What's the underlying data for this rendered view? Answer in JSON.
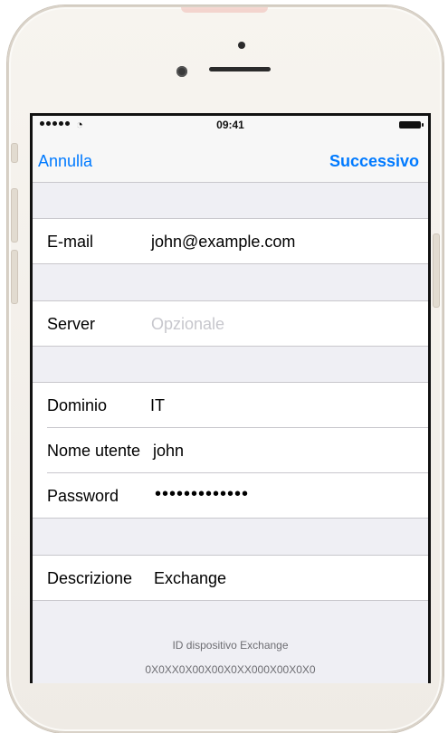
{
  "status_bar": {
    "time": "09:41",
    "signal_icon": "signal-dots-icon",
    "wifi_icon": "wifi-icon",
    "battery_icon": "battery-icon"
  },
  "navbar": {
    "cancel_label": "Annulla",
    "next_label": "Successivo",
    "accent_color": "#007aff"
  },
  "fields": {
    "email": {
      "label": "E-mail",
      "value": "john@example.com"
    },
    "server": {
      "label": "Server",
      "placeholder": "Opzionale"
    },
    "domain": {
      "label": "Dominio",
      "value": "IT"
    },
    "username": {
      "label": "Nome utente",
      "value": "john"
    },
    "password": {
      "label": "Password",
      "value": "•••••••••••••"
    },
    "description": {
      "label": "Descrizione",
      "value": "Exchange"
    }
  },
  "footer": {
    "device_id_label": "ID dispositivo Exchange",
    "device_id_value": "0X0XX0X00X00X0XX000X00X0X0"
  }
}
